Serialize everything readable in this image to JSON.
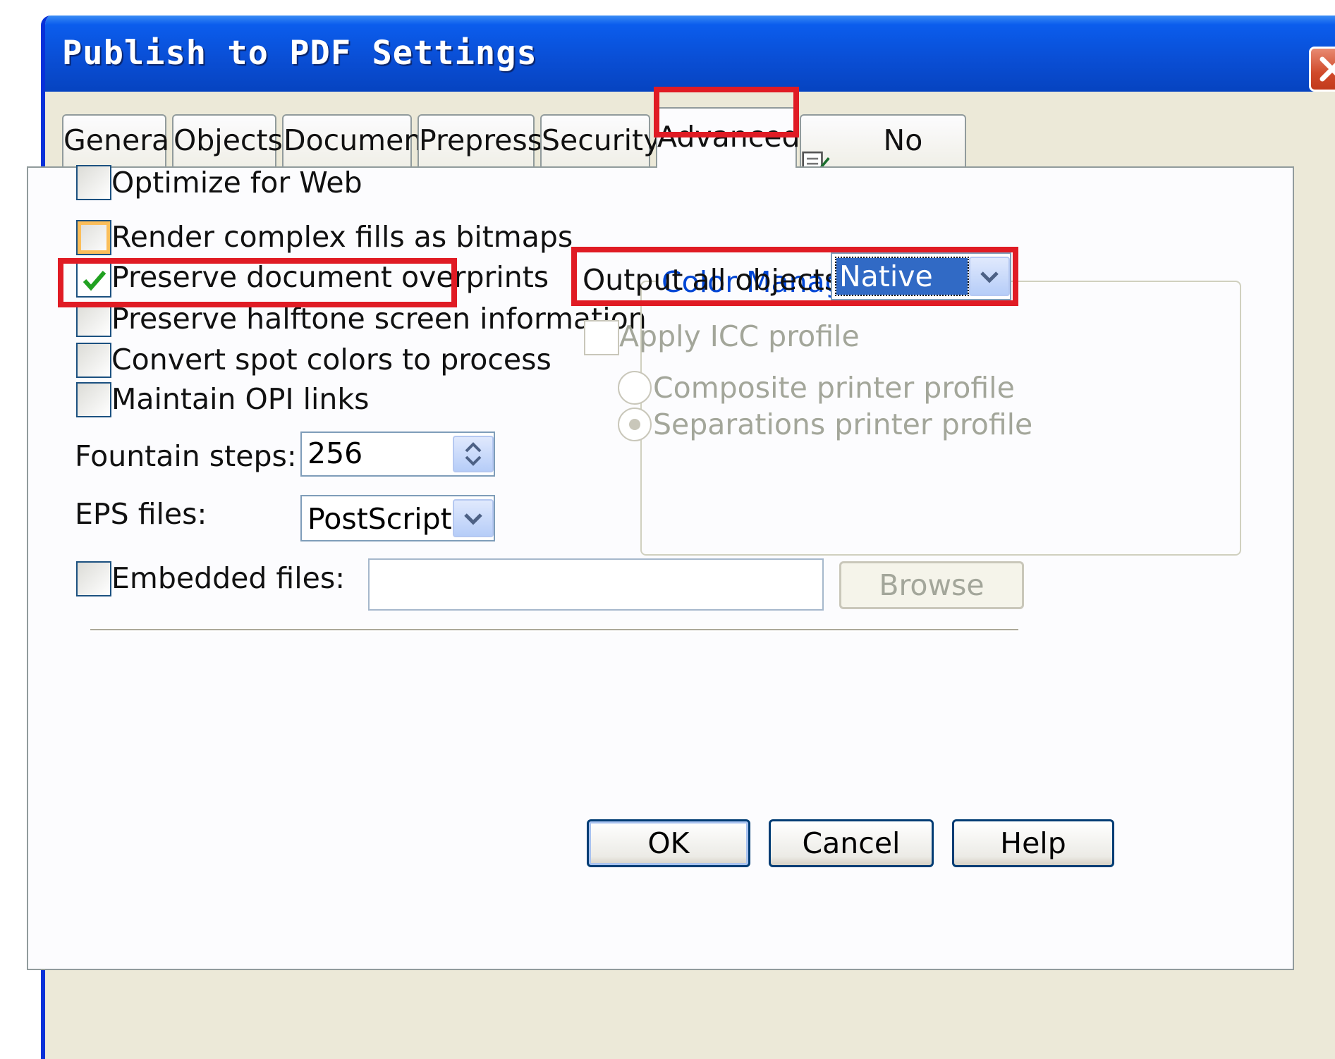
{
  "window": {
    "title": "Publish to PDF Settings"
  },
  "tabs": [
    {
      "label": "General"
    },
    {
      "label": "Objects"
    },
    {
      "label": "Document"
    },
    {
      "label": "Prepress"
    },
    {
      "label": "Security"
    },
    {
      "label": "Advanced",
      "active": true
    },
    {
      "label": "No Issues",
      "icon": "checklist-icon"
    }
  ],
  "options": {
    "optimize_web": {
      "label": "Optimize for Web",
      "checked": false
    },
    "render_complex": {
      "label": "Render complex fills as bitmaps",
      "checked": false
    },
    "preserve_overprints": {
      "label": "Preserve document overprints",
      "checked": true
    },
    "preserve_halftone": {
      "label": "Preserve halftone screen information",
      "checked": false
    },
    "convert_spot": {
      "label": "Convert spot colors to process",
      "checked": false
    },
    "maintain_opi": {
      "label": "Maintain OPI links",
      "checked": false
    }
  },
  "fountain_steps": {
    "label": "Fountain steps:",
    "value": "256"
  },
  "eps_files": {
    "label": "EPS files:",
    "value": "PostScript"
  },
  "embedded_files": {
    "label": "Embedded files:",
    "checked": false,
    "value": "",
    "browse_label": "Browse"
  },
  "color_management": {
    "title": "Color Management",
    "output_label": "Output all objects as:",
    "output_value": "Native",
    "apply_icc": {
      "label": "Apply ICC profile",
      "checked": false
    },
    "composite": {
      "label": "Composite printer profile",
      "selected": false
    },
    "separations": {
      "label": "Separations printer profile",
      "selected": true
    }
  },
  "buttons": {
    "ok": "OK",
    "cancel": "Cancel",
    "help": "Help"
  },
  "colors": {
    "title_blue": "#0b5ded",
    "highlight_red": "#e01b24",
    "group_title": "#0046d5"
  }
}
